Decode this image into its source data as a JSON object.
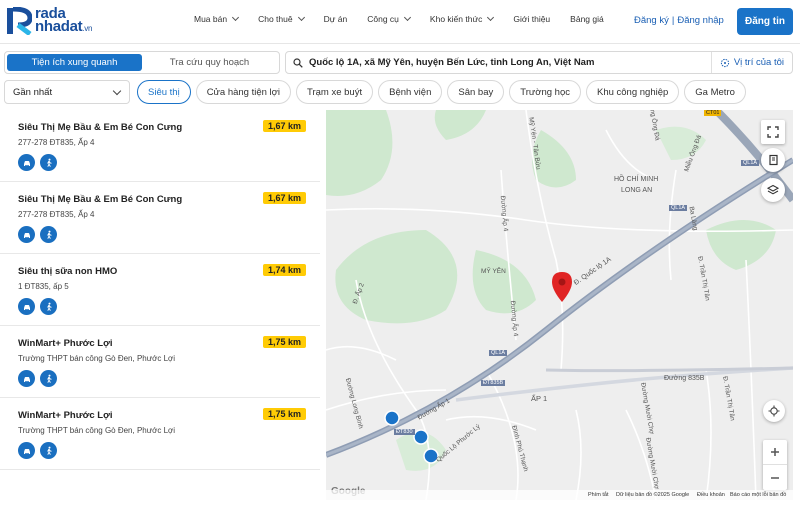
{
  "brand": {
    "line1": "rada",
    "line2": "nhadat",
    "suffix": ".vn"
  },
  "nav": [
    {
      "label": "Mua bán",
      "dropdown": true
    },
    {
      "label": "Cho thuê",
      "dropdown": true
    },
    {
      "label": "Dự án",
      "dropdown": false
    },
    {
      "label": "Công cụ",
      "dropdown": true
    },
    {
      "label": "Kho kiến thức",
      "dropdown": true
    },
    {
      "label": "Giới thiệu",
      "dropdown": false
    },
    {
      "label": "Bảng giá",
      "dropdown": false
    }
  ],
  "auth": {
    "register": "Đăng ký",
    "separator": "|",
    "login": "Đăng nhập",
    "post": "Đăng tin"
  },
  "tabs": {
    "active": "Tiện ích xung quanh",
    "other": "Tra cứu quy hoạch"
  },
  "address": {
    "value": "Quốc lộ 1A, xã Mỹ Yên, huyện Bến Lức, tỉnh Long An, Việt Nam",
    "locate": "Vị trí của tôi"
  },
  "sort": {
    "selected": "Gần nhất"
  },
  "chips": [
    "Siêu thị",
    "Cửa hàng tiện lợi",
    "Trạm xe buýt",
    "Bệnh viện",
    "Sân bay",
    "Trường học",
    "Khu công nghiệp",
    "Ga Metro"
  ],
  "results": [
    {
      "name": "Siêu Thị Mẹ Bầu & Em Bé Con Cưng",
      "address": "277-278 ĐT835, Ấp 4",
      "distance": "1,67 km"
    },
    {
      "name": "Siêu Thị Mẹ Bầu & Em Bé Con Cưng",
      "address": "277-278 ĐT835, Ấp 4",
      "distance": "1,67 km"
    },
    {
      "name": "Siêu thị sữa non HMO",
      "address": "1 ĐT835, ấp 5",
      "distance": "1,74 km"
    },
    {
      "name": "WinMart+ Phước Lợi",
      "address": "Trường THPT bán công Gò Đen, Phước Lợi",
      "distance": "1,75 km"
    },
    {
      "name": "WinMart+ Phước Lợi",
      "address": "Trường THPT bán công Gò Đen, Phước Lợi",
      "distance": "1,75 km"
    }
  ],
  "map": {
    "labels": {
      "city": "HỒ CHÍ MINH",
      "province": "LONG AN",
      "myyen": "MỸ YÊN",
      "ap1": "ẤP 1",
      "ql1a_road": "Đ. Quốc lộ 1A",
      "ql1a_badge1": "QL1A",
      "ql1a_badge2": "QL1A",
      "ql1a_badge3": "QL1A",
      "ct01": "CT01",
      "dt835b": "ĐT835B",
      "dt830": "ĐT830",
      "duong835b": "Đường 835B",
      "myyen_tanbuu": "Mỹ Yên - Tân Bửu",
      "ap4a": "Đường Ấp 4",
      "ap4b": "Đường Ấp 4",
      "ap2": "Đ. Ấp 2",
      "apx": "Đường Ấp 1",
      "longbinh": "Đường Long Bình",
      "quocloi": "Quốc Lộ Phước Lý",
      "dinhphu": "Đình Phú Thạnh",
      "duongmuoi": "Đường Mười Chợ",
      "duongmuoi2": "Đường Mười Chợ",
      "trantrong": "Đ. Trần Thị Tân",
      "trantrong2": "Đ. Trần Thị Tân",
      "balang": "Ba Làng",
      "mieudong": "Miễu Ông Đá",
      "ongda": "Đường Ông Đá"
    },
    "footer": {
      "shortcuts": "Phím tắt",
      "mapdata": "Dữ liệu bản đồ ©2025 Google",
      "terms": "Điều khoản",
      "report": "Báo cáo một lỗi bản đồ"
    },
    "google": "Google"
  }
}
